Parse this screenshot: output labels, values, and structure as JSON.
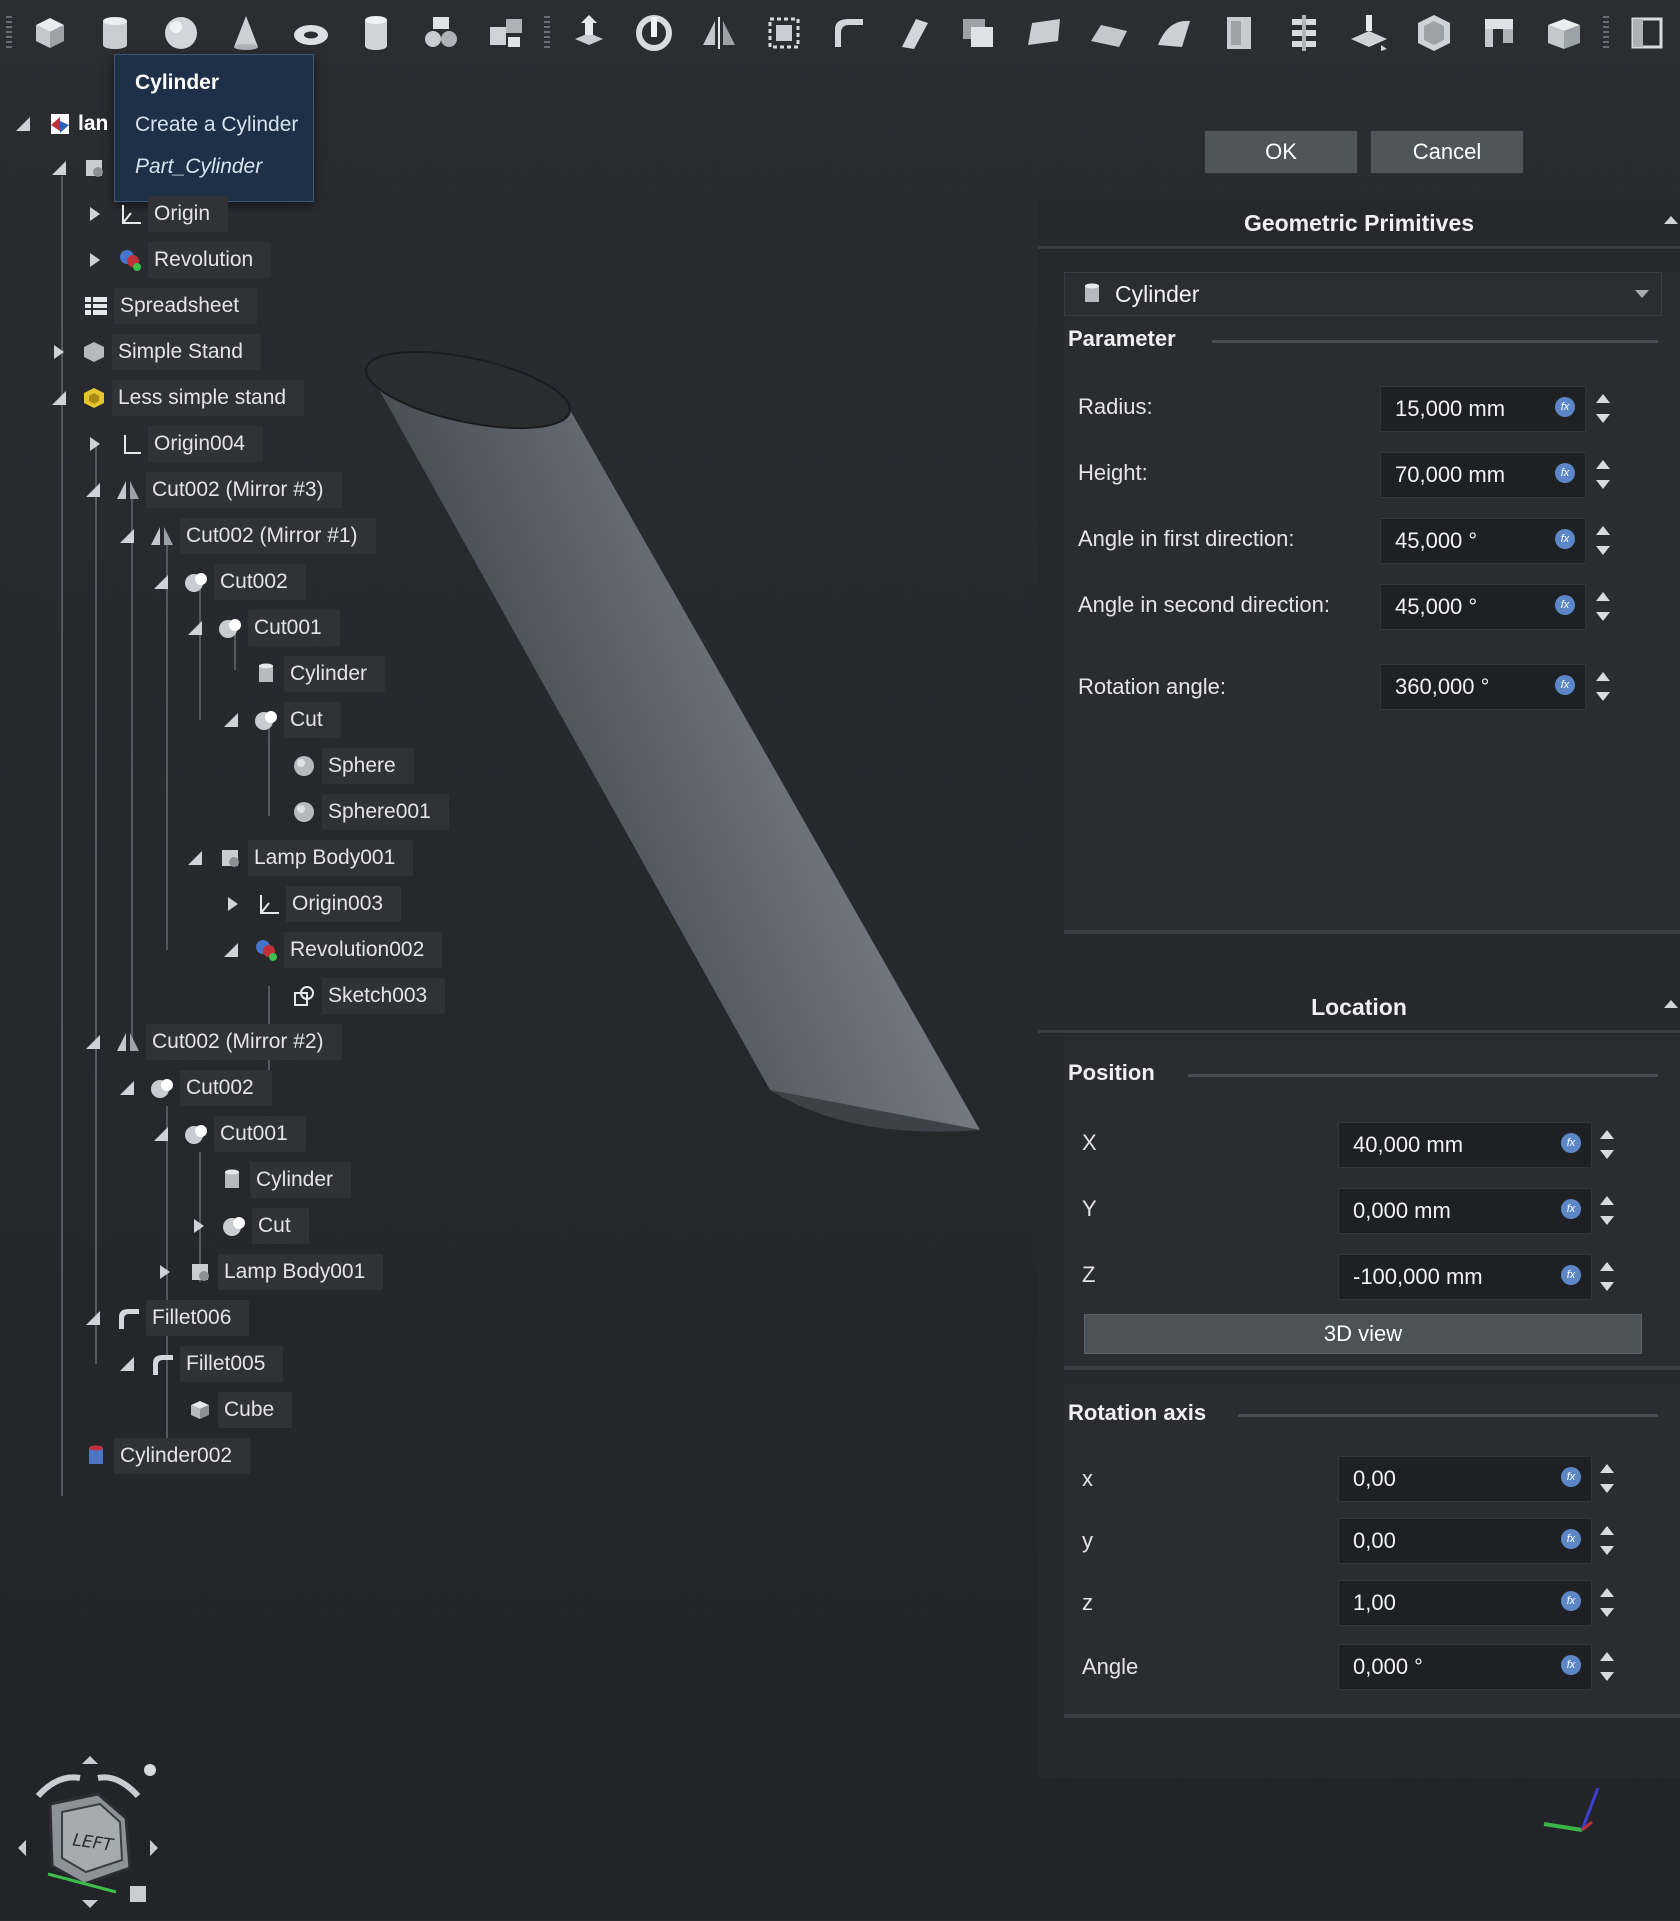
{
  "toolbar": {
    "icons": [
      "cube-icon",
      "cylinder-icon",
      "sphere-icon",
      "cone-icon",
      "torus-icon",
      "tube-icon",
      "primitives-icon",
      "shape-builder-icon",
      "extrude-icon",
      "revolve-icon",
      "mirror-icon",
      "fillet-icon",
      "chamfer-icon",
      "make-face-icon",
      "ruled-surface-icon",
      "loft-icon",
      "sweep-icon",
      "section-icon",
      "cross-sections-icon",
      "offset-icon",
      "thickness-icon",
      "projection-icon",
      "boolean-icon",
      "compound-icon",
      "box-extra-icon"
    ]
  },
  "tooltip": {
    "title": "Cylinder",
    "description": "Create a Cylinder",
    "command": "Part_Cylinder"
  },
  "tree": {
    "root_label": "lan",
    "items": [
      {
        "label": "Origin"
      },
      {
        "label": "Revolution"
      },
      {
        "label": "Spreadsheet"
      },
      {
        "label": "Simple Stand"
      },
      {
        "label": "Less simple stand"
      },
      {
        "label": "Origin004"
      },
      {
        "label": "Cut002 (Mirror #3)"
      },
      {
        "label": "Cut002 (Mirror #1)"
      },
      {
        "label": "Cut002"
      },
      {
        "label": "Cut001"
      },
      {
        "label": "Cylinder"
      },
      {
        "label": "Cut"
      },
      {
        "label": "Sphere"
      },
      {
        "label": "Sphere001"
      },
      {
        "label": "Lamp Body001"
      },
      {
        "label": "Origin003"
      },
      {
        "label": "Revolution002"
      },
      {
        "label": "Sketch003"
      },
      {
        "label": "Cut002 (Mirror #2)"
      },
      {
        "label": "Cut002"
      },
      {
        "label": "Cut001"
      },
      {
        "label": "Cylinder"
      },
      {
        "label": "Cut"
      },
      {
        "label": "Lamp Body001"
      },
      {
        "label": "Fillet006"
      },
      {
        "label": "Fillet005"
      },
      {
        "label": "Cube"
      },
      {
        "label": "Cylinder002"
      }
    ]
  },
  "dialog": {
    "ok_label": "OK",
    "cancel_label": "Cancel"
  },
  "primitives": {
    "header": "Geometric Primitives",
    "type_selected": "Cylinder",
    "parameter_title": "Parameter",
    "radius": {
      "label": "Radius:",
      "value": "15,000 mm"
    },
    "height": {
      "label": "Height:",
      "value": "70,000 mm"
    },
    "angle1": {
      "label": "Angle in first direction:",
      "value": "45,000 °"
    },
    "angle2": {
      "label": "Angle in second direction:",
      "value": "45,000 °"
    },
    "rotation": {
      "label": "Rotation angle:",
      "value": "360,000 °"
    }
  },
  "location": {
    "header": "Location",
    "position_title": "Position",
    "x": {
      "label": "X",
      "value": "40,000 mm"
    },
    "y": {
      "label": "Y",
      "value": "0,000 mm"
    },
    "z": {
      "label": "Z",
      "value": "-100,000 mm"
    },
    "view3d_label": "3D view",
    "axis_title": "Rotation axis",
    "ax": {
      "label": "x",
      "value": "0,00"
    },
    "ay": {
      "label": "y",
      "value": "0,00"
    },
    "az": {
      "label": "z",
      "value": "1,00"
    },
    "angle": {
      "label": "Angle",
      "value": "0,000 °"
    }
  },
  "navcube": {
    "face_label": "LEFT"
  },
  "colors": {
    "accent": "#5b87c7",
    "tooltip_bg": "#1d3047",
    "panel_bg": "#26282c"
  }
}
